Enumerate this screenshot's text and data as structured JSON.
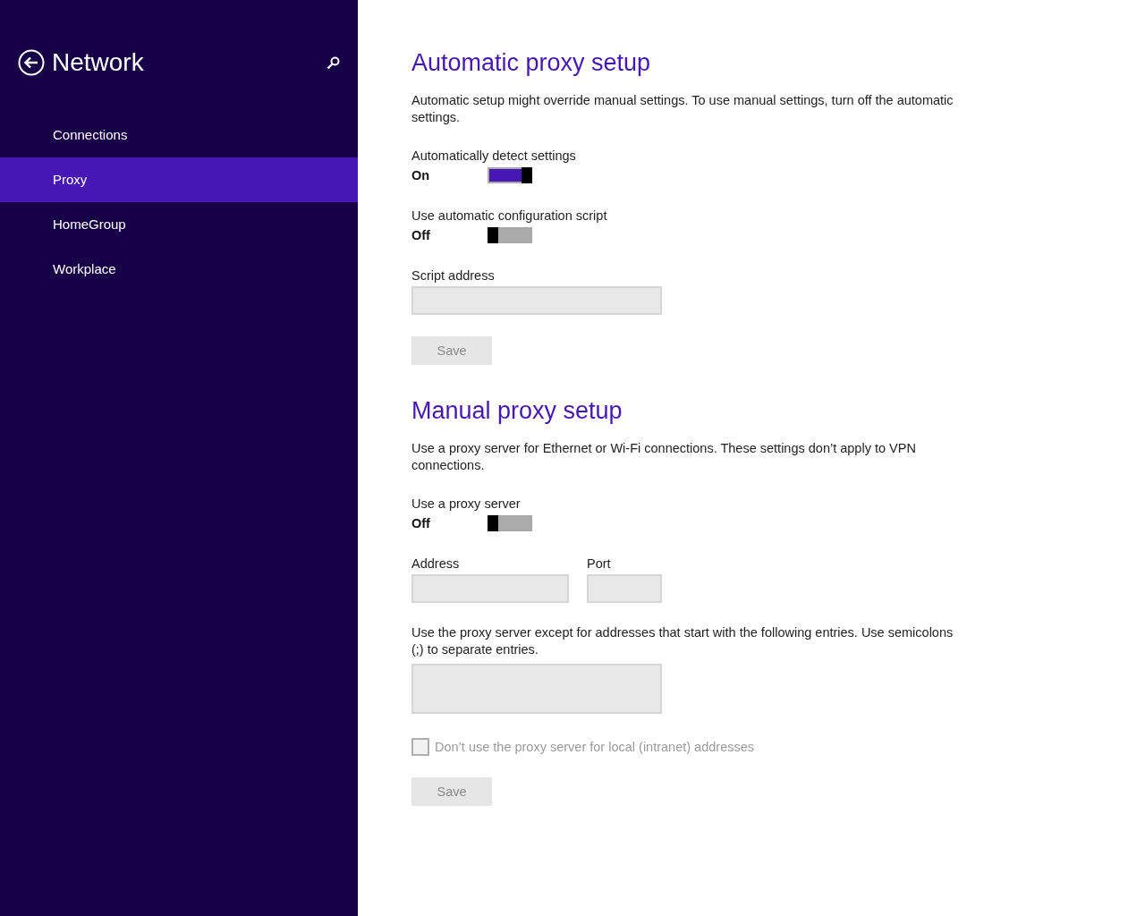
{
  "header": {
    "title": "Network"
  },
  "nav": [
    {
      "label": "Connections",
      "selected": false
    },
    {
      "label": "Proxy",
      "selected": true
    },
    {
      "label": "HomeGroup",
      "selected": false
    },
    {
      "label": "Workplace",
      "selected": false
    }
  ],
  "sections": [
    {
      "title": "Automatic proxy setup",
      "description": "Automatic setup might override manual settings. To use manual settings, turn off the automatic settings.",
      "items": [
        {
          "kind": "toggle",
          "label": "Automatically detect settings",
          "state_text": "On",
          "on": true
        },
        {
          "kind": "toggle",
          "label": "Use automatic configuration script",
          "state_text": "Off",
          "on": false
        },
        {
          "kind": "fields",
          "fields": [
            {
              "label": "Script address"
            }
          ]
        },
        {
          "kind": "button",
          "label": "Save",
          "disabled": true
        }
      ]
    },
    {
      "title": "Manual proxy setup",
      "description": "Use a proxy server for Ethernet or Wi-Fi connections. These settings don’t apply to VPN connections.",
      "items": [
        {
          "kind": "toggle",
          "label": "Use a proxy server",
          "state_text": "Off",
          "on": false
        },
        {
          "kind": "fields",
          "fields": [
            {
              "label": "Address"
            },
            {
              "label": "Port"
            }
          ]
        },
        {
          "kind": "textarea",
          "label": "Use the proxy server except for addresses that start with the following entries. Use semicolons (;) to separate entries."
        },
        {
          "kind": "checkbox",
          "label": "Don’t use the proxy server for local (intranet) addresses",
          "checked": false,
          "disabled": true
        },
        {
          "kind": "button",
          "label": "Save",
          "disabled": true
        }
      ]
    }
  ]
}
